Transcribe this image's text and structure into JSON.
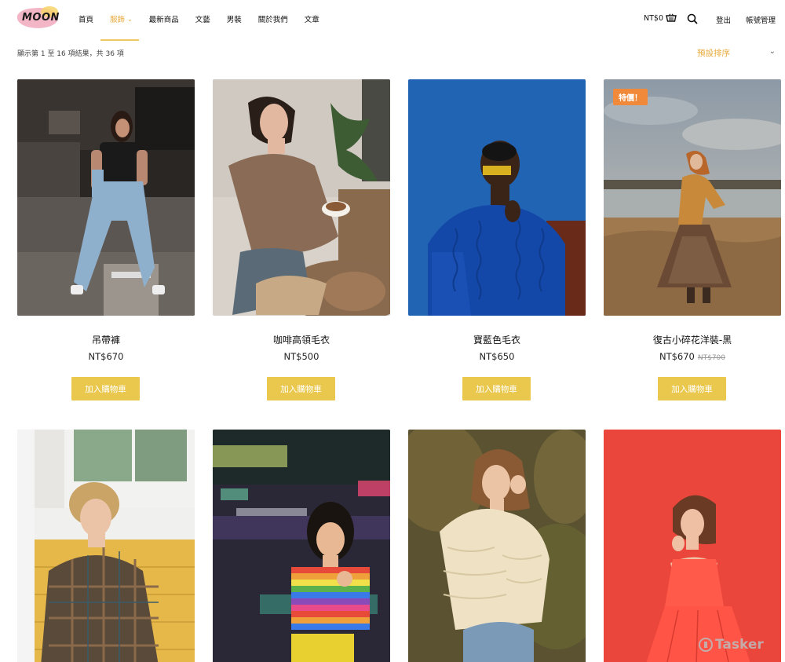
{
  "header": {
    "logo_text": "MOON",
    "nav": [
      {
        "label": "首頁",
        "active": false
      },
      {
        "label": "服飾",
        "active": true,
        "has_dropdown": true
      },
      {
        "label": "最新商品",
        "active": false
      },
      {
        "label": "文藝",
        "active": false
      },
      {
        "label": "男裝",
        "active": false
      },
      {
        "label": "關於我們",
        "active": false
      },
      {
        "label": "文章",
        "active": false
      }
    ],
    "cart_total": "NT$0",
    "logout_label": "登出",
    "account_label": "帳號管理",
    "accent_color": "#e8a93a"
  },
  "toolbar": {
    "result_count": "顯示第 1 至 16 項結果，共 36 項",
    "sort_label": "預設排序"
  },
  "products": [
    {
      "name": "吊帶褲",
      "price": "NT$670",
      "old_price": "",
      "sale_badge": "",
      "button": "加入購物車"
    },
    {
      "name": "咖啡高領毛衣",
      "price": "NT$500",
      "old_price": "",
      "sale_badge": "",
      "button": "加入購物車"
    },
    {
      "name": "寶藍色毛衣",
      "price": "NT$650",
      "old_price": "",
      "sale_badge": "",
      "button": "加入購物車"
    },
    {
      "name": "復古小碎花洋裝-黑",
      "price": "NT$670",
      "old_price": "NT$700",
      "sale_badge": "特價！",
      "button": "加入購物車"
    },
    {
      "name": "",
      "price": "",
      "old_price": "",
      "sale_badge": "",
      "button": ""
    },
    {
      "name": "",
      "price": "",
      "old_price": "",
      "sale_badge": "",
      "button": ""
    },
    {
      "name": "",
      "price": "",
      "old_price": "",
      "sale_badge": "",
      "button": ""
    },
    {
      "name": "",
      "price": "",
      "old_price": "",
      "sale_badge": "",
      "button": ""
    }
  ],
  "icons": {
    "cart": "cart-icon",
    "search": "search-icon",
    "sort": "chevron-down-icon"
  },
  "watermark": "Tasker",
  "colors": {
    "button": "#eac84d",
    "sale_badge": "#f08a3a"
  }
}
